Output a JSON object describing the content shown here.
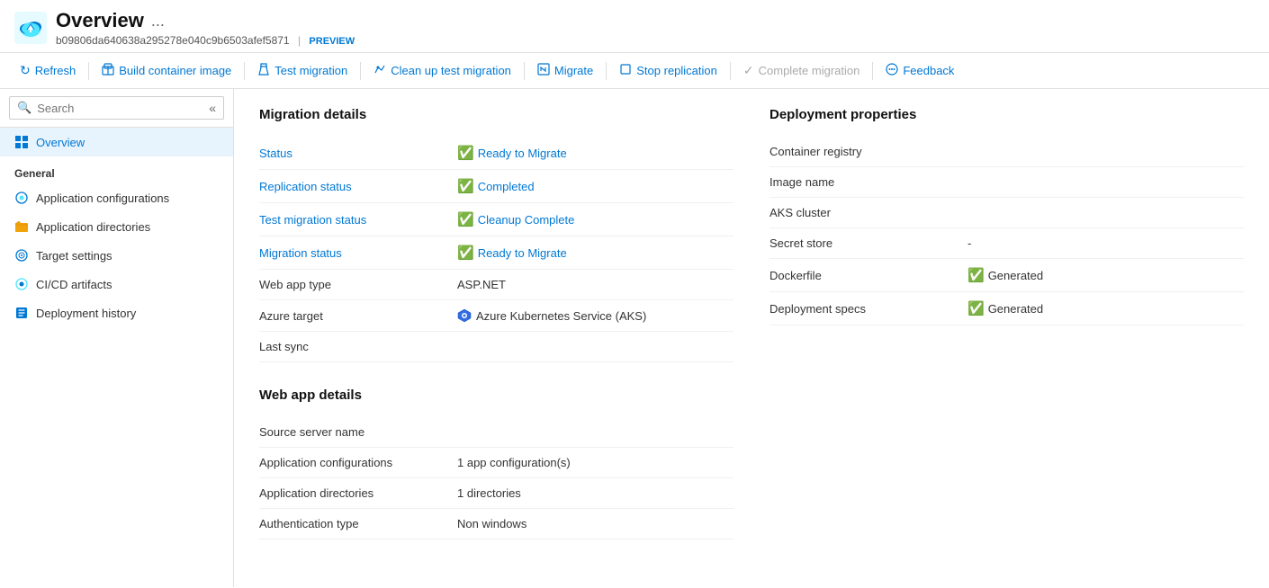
{
  "header": {
    "title": "Overview",
    "ellipsis": "...",
    "subtitle_id": "b09806da640638a295278e040c9b6503afef5871",
    "subtitle_separator": "|",
    "subtitle_preview": "PREVIEW"
  },
  "toolbar": {
    "buttons": [
      {
        "id": "refresh",
        "label": "Refresh",
        "icon": "↻",
        "disabled": false
      },
      {
        "id": "build-container-image",
        "label": "Build container image",
        "icon": "🏗",
        "disabled": false
      },
      {
        "id": "test-migration",
        "label": "Test migration",
        "icon": "⚗",
        "disabled": false
      },
      {
        "id": "clean-up-test-migration",
        "label": "Clean up test migration",
        "icon": "🔧",
        "disabled": false
      },
      {
        "id": "migrate",
        "label": "Migrate",
        "icon": "⬆",
        "disabled": false
      },
      {
        "id": "stop-replication",
        "label": "Stop replication",
        "icon": "⬜",
        "disabled": false
      },
      {
        "id": "complete-migration",
        "label": "Complete migration",
        "icon": "✓",
        "disabled": true
      },
      {
        "id": "feedback",
        "label": "Feedback",
        "icon": "💬",
        "disabled": false
      }
    ]
  },
  "sidebar": {
    "search_placeholder": "Search",
    "items": [
      {
        "id": "overview",
        "label": "Overview",
        "active": true
      },
      {
        "id": "section-general",
        "label": "General",
        "is_section": true
      },
      {
        "id": "app-configurations",
        "label": "Application configurations",
        "active": false
      },
      {
        "id": "app-directories",
        "label": "Application directories",
        "active": false
      },
      {
        "id": "target-settings",
        "label": "Target settings",
        "active": false
      },
      {
        "id": "cicd-artifacts",
        "label": "CI/CD artifacts",
        "active": false
      },
      {
        "id": "deployment-history",
        "label": "Deployment history",
        "active": false
      }
    ]
  },
  "main": {
    "migration_details": {
      "section_title": "Migration details",
      "rows": [
        {
          "label": "Status",
          "label_type": "link",
          "value": "Ready to Migrate",
          "value_type": "status"
        },
        {
          "label": "Replication status",
          "label_type": "link",
          "value": "Completed",
          "value_type": "status"
        },
        {
          "label": "Test migration status",
          "label_type": "link",
          "value": "Cleanup Complete",
          "value_type": "status"
        },
        {
          "label": "Migration status",
          "label_type": "link",
          "value": "Ready to Migrate",
          "value_type": "status"
        },
        {
          "label": "Web app type",
          "label_type": "plain",
          "value": "ASP.NET",
          "value_type": "plain"
        },
        {
          "label": "Azure target",
          "label_type": "plain",
          "value": "Azure Kubernetes Service (AKS)",
          "value_type": "aks"
        },
        {
          "label": "Last sync",
          "label_type": "plain",
          "value": "",
          "value_type": "plain"
        }
      ]
    },
    "web_app_details": {
      "section_title": "Web app details",
      "rows": [
        {
          "label": "Source server name",
          "label_type": "plain",
          "value": "",
          "value_type": "plain"
        },
        {
          "label": "Application configurations",
          "label_type": "plain",
          "value": "1 app configuration(s)",
          "value_type": "plain"
        },
        {
          "label": "Application directories",
          "label_type": "plain",
          "value": "1 directories",
          "value_type": "plain"
        },
        {
          "label": "Authentication type",
          "label_type": "plain",
          "value": "Non windows",
          "value_type": "plain"
        }
      ]
    },
    "deployment_properties": {
      "section_title": "Deployment properties",
      "rows": [
        {
          "label": "Container registry",
          "label_type": "plain",
          "value": "",
          "value_type": "plain"
        },
        {
          "label": "Image name",
          "label_type": "plain",
          "value": "",
          "value_type": "plain"
        },
        {
          "label": "AKS cluster",
          "label_type": "plain",
          "value": "",
          "value_type": "plain"
        },
        {
          "label": "Secret store",
          "label_type": "plain",
          "value": "-",
          "value_type": "plain"
        },
        {
          "label": "Dockerfile",
          "label_type": "plain",
          "value": "Generated",
          "value_type": "generated"
        },
        {
          "label": "Deployment specs",
          "label_type": "plain",
          "value": "Generated",
          "value_type": "generated"
        }
      ]
    }
  }
}
